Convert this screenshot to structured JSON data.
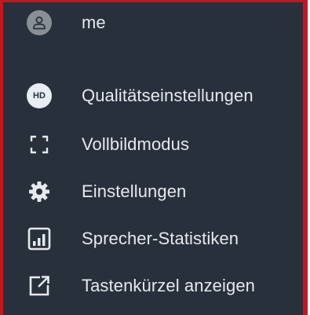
{
  "menu": {
    "items": [
      {
        "label": "me",
        "icon": "user-avatar-icon"
      },
      {
        "label": "Qualitätseinstellungen",
        "icon": "hd-icon",
        "icon_text": "HD"
      },
      {
        "label": "Vollbildmodus",
        "icon": "fullscreen-icon"
      },
      {
        "label": "Einstellungen",
        "icon": "gear-icon"
      },
      {
        "label": "Sprecher-Statistiken",
        "icon": "bar-chart-icon"
      },
      {
        "label": "Tastenkürzel anzeigen",
        "icon": "external-link-icon"
      }
    ]
  },
  "colors": {
    "menu_background": "#28303b",
    "text": "#e6e9ee",
    "frame_border": "#c4161c"
  }
}
